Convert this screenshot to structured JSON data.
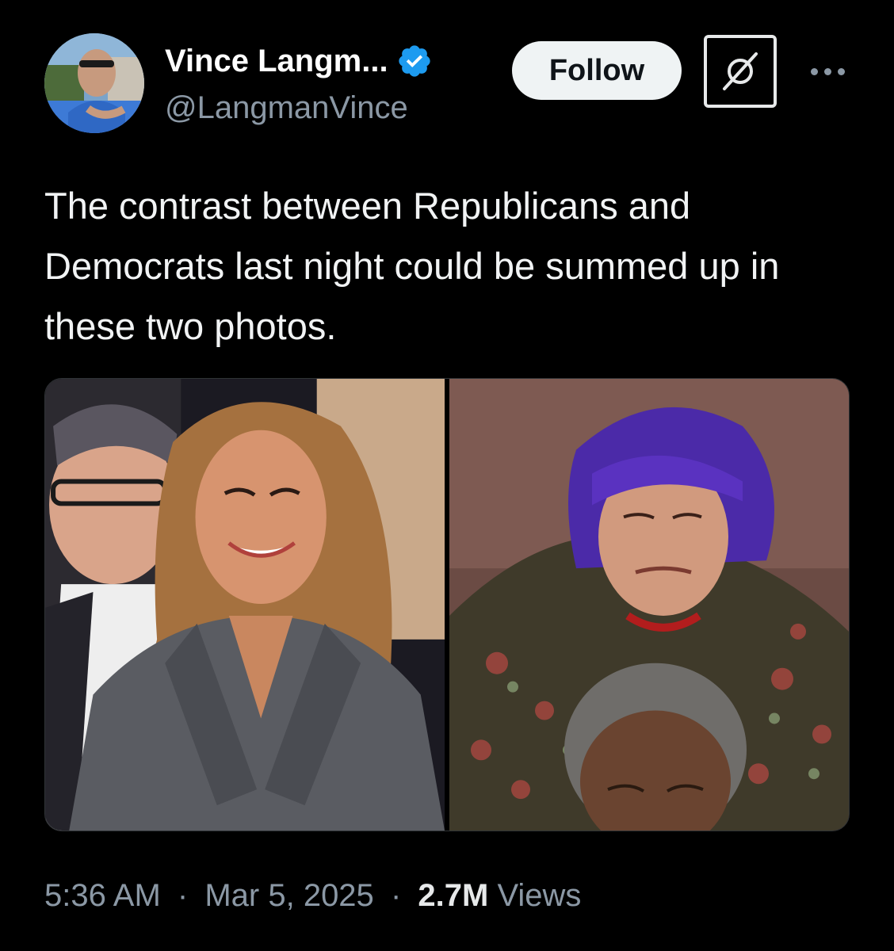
{
  "author": {
    "display_name": "Vince Langm...",
    "handle": "@LangmanVince",
    "verified": true,
    "avatar_icon": "profile-photo"
  },
  "actions": {
    "follow_label": "Follow",
    "grok_icon": "grok-icon",
    "more_icon": "more-options-icon"
  },
  "tweet": {
    "text": "The contrast between Republicans and Democrats last night could be summed up in these two photos."
  },
  "media": {
    "photos": [
      {
        "icon": "photo-left"
      },
      {
        "icon": "photo-right"
      }
    ]
  },
  "meta": {
    "time": "5:36 AM",
    "date": "Mar 5, 2025",
    "views_count": "2.7M",
    "views_label": "Views",
    "separator": "·"
  },
  "colors": {
    "background": "#000000",
    "text": "#e7e9ea",
    "muted": "#8b98a5",
    "verified": "#1d9bf0",
    "follow_bg": "#eff3f4"
  }
}
